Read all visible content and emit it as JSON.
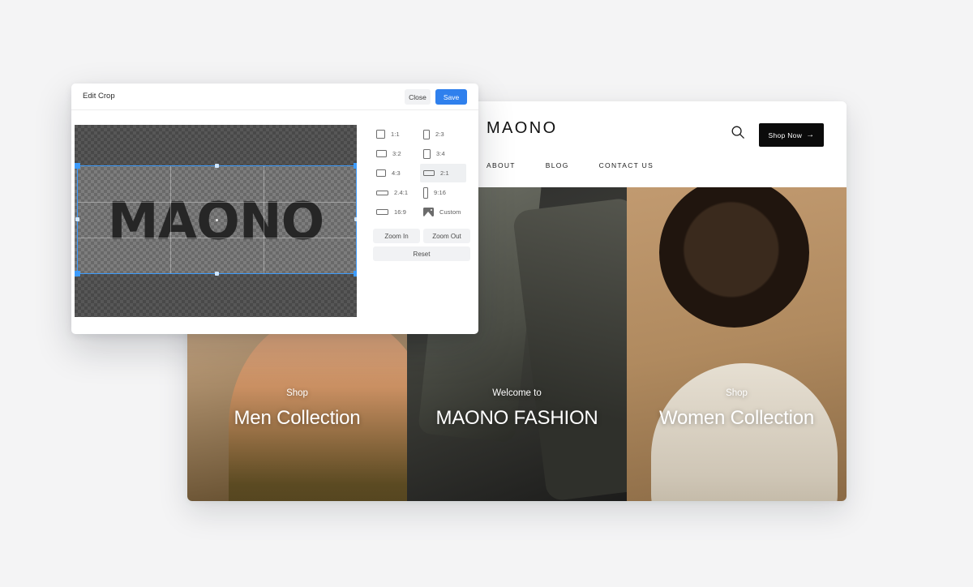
{
  "page": {
    "background_color": "#f4f4f5"
  },
  "modal": {
    "title": "Edit Crop",
    "close_label": "Close",
    "save_label": "Save",
    "save_color": "#2f80ed",
    "crop": {
      "image_text": "MAONO",
      "selection_ratio": "2:1",
      "handle_color": "#3d9bfb"
    },
    "ratios": [
      {
        "label": "1:1",
        "icon": "aspect-1x1-icon",
        "selected": false
      },
      {
        "label": "2:3",
        "icon": "aspect-2x3-icon",
        "selected": false
      },
      {
        "label": "3:2",
        "icon": "aspect-3x2-icon",
        "selected": false
      },
      {
        "label": "3:4",
        "icon": "aspect-3x4-icon",
        "selected": false
      },
      {
        "label": "4:3",
        "icon": "aspect-4x3-icon",
        "selected": false
      },
      {
        "label": "2:1",
        "icon": "aspect-2x1-icon",
        "selected": true
      },
      {
        "label": "2.4:1",
        "icon": "aspect-24x1-icon",
        "selected": false
      },
      {
        "label": "9:16",
        "icon": "aspect-9x16-icon",
        "selected": false
      },
      {
        "label": "16:9",
        "icon": "aspect-16x9-icon",
        "selected": false
      },
      {
        "label": "Custom",
        "icon": "custom-image-icon",
        "selected": false
      }
    ],
    "zoom_in_label": "Zoom In",
    "zoom_out_label": "Zoom Out",
    "reset_label": "Reset"
  },
  "site": {
    "logo": "MAONO",
    "search_icon": "search-icon",
    "shop_now_label": "Shop Now",
    "shop_now_arrow": "→",
    "nav": [
      {
        "label": "ABOUT"
      },
      {
        "label": "BLOG"
      },
      {
        "label": "CONTACT US"
      }
    ],
    "panels": [
      {
        "kicker": "Shop",
        "title": "Men Collection"
      },
      {
        "kicker": "Welcome to",
        "title": "MAONO FASHION"
      },
      {
        "kicker": "Shop",
        "title": "Women Collection"
      }
    ]
  }
}
